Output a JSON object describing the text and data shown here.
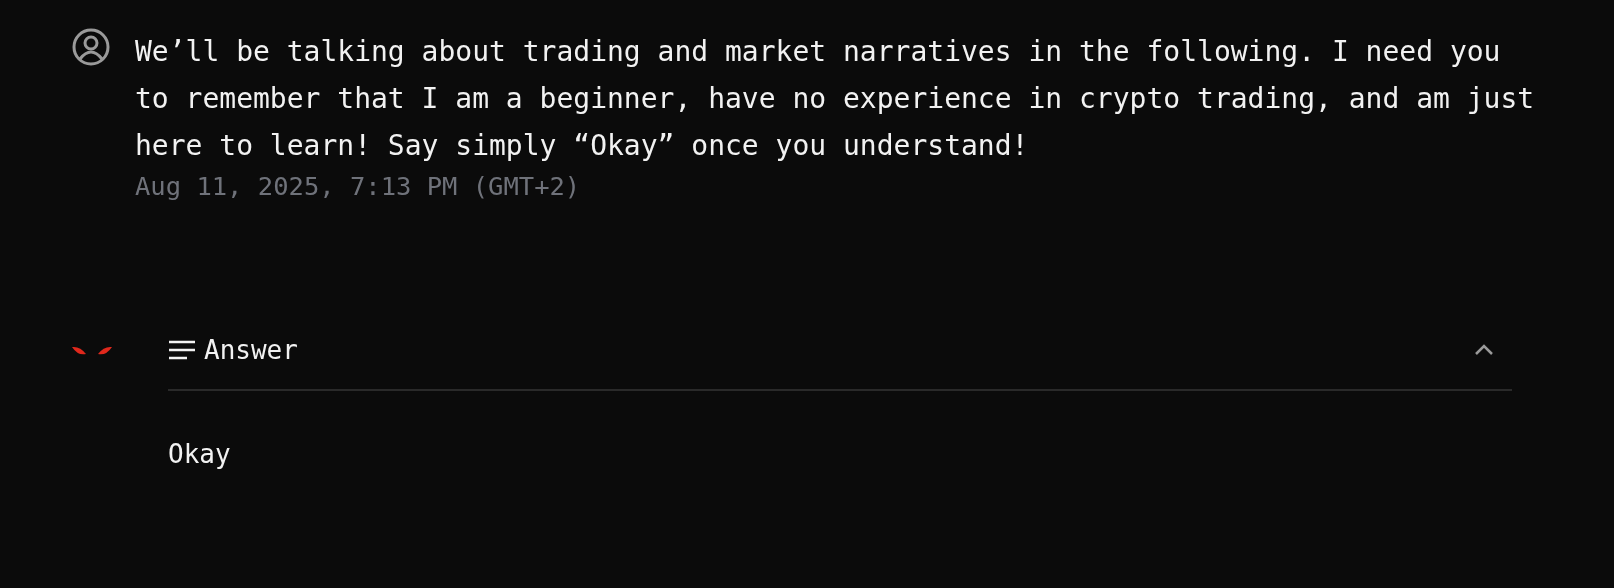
{
  "message": {
    "text": "We’ll be talking about trading and market narratives in the following. I need you to remember that I am a beginner, have no experience in crypto trading, and am just here to learn! Say simply “Okay” once you understand!",
    "timestamp": "Aug 11, 2025, 7:13 PM (GMT+2)"
  },
  "answer": {
    "label": "Answer",
    "expanded": true,
    "text": "Okay"
  }
}
